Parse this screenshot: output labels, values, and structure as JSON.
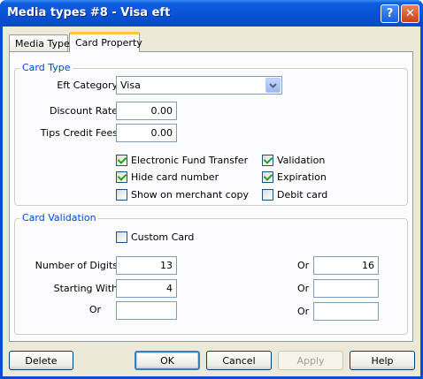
{
  "window": {
    "title": "Media types #8 - Visa eft"
  },
  "titlebar": {
    "help_glyph": "?",
    "close_glyph": "✕"
  },
  "tabs": [
    {
      "label": "Media Type",
      "active": false
    },
    {
      "label": "Card Property",
      "active": true
    }
  ],
  "card_type": {
    "group_label": "Card Type",
    "eft_category_label": "Eft Category",
    "eft_category_value": "Visa",
    "discount_rate_label": "Discount Rate",
    "discount_rate_value": "0.00",
    "tips_credit_fees_label": "Tips Credit Fees",
    "tips_credit_fees_value": "0.00",
    "checkboxes": [
      {
        "label": "Electronic Fund Transfer",
        "checked": true
      },
      {
        "label": "Validation",
        "checked": true
      },
      {
        "label": "Hide card number",
        "checked": true
      },
      {
        "label": "Expiration",
        "checked": true
      },
      {
        "label": "Show on merchant copy",
        "checked": false
      },
      {
        "label": "Debit card",
        "checked": false
      }
    ]
  },
  "card_validation": {
    "group_label": "Card Validation",
    "custom_card_label": "Custom Card",
    "custom_card_checked": false,
    "number_of_digits_label": "Number of Digits",
    "number_of_digits_value": "13",
    "number_of_digits_or_label": "Or",
    "number_of_digits_or_value": "16",
    "starting_with_label": "Starting With",
    "starting_with_value": "4",
    "starting_with_or_label": "Or",
    "starting_with_or_value": "",
    "or_label": "Or",
    "or_value": "",
    "or2_label": "Or",
    "or2_value": ""
  },
  "buttons": {
    "delete": "Delete",
    "ok": "OK",
    "cancel": "Cancel",
    "apply": "Apply",
    "help": "Help"
  }
}
